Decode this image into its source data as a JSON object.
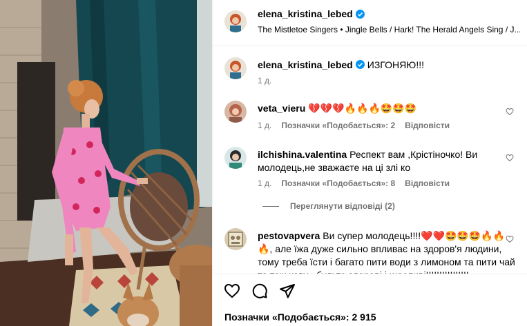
{
  "post": {
    "author": "elena_kristina_lebed",
    "audio": "The Mistletoe Singers • Jingle Bells / Hark! The Herald Angels Sing / J..."
  },
  "caption": {
    "username": "elena_kristina_lebed",
    "text": "ИЗГОНЯЮ!!!",
    "time": "1 д."
  },
  "comments": [
    {
      "username": "veta_vieru",
      "text": "💔💔💔🔥🔥🔥🤩🤩🤩",
      "time": "1 д.",
      "likes": "Позначки «Подобається»: 2",
      "reply": "Відповісти"
    },
    {
      "username": "ilchishina.valentina",
      "text": "Респект вам ,Крістіночко! Ви молодець,не зважаєте на ці злі ко",
      "time": "1 д.",
      "likes": "Позначки «Подобається»: 8",
      "reply": "Відповісти",
      "view_replies": "Переглянути відповіді (2)"
    },
    {
      "username": "pestovapvera",
      "text": "Ви супер молодець!!!!❤️❤️🤩🤩🤩🔥🔥🔥, але їжа дуже сильно впливає на здоров'я людини, тому треба їсти і багато пити води з лимоном та пити чай та теж каву , будьте здорові і щасливі!!!!!!!!!!!!!!!!"
    }
  ],
  "footer": {
    "likes": "Позначки «Подобається»: 2 915"
  },
  "icons": {
    "like": "heart-icon",
    "comment": "comment-icon",
    "share": "share-icon",
    "verified": "verified-badge-icon"
  },
  "colors": {
    "verified": "#0095f6",
    "muted": "#737373",
    "divider": "#efefef"
  }
}
